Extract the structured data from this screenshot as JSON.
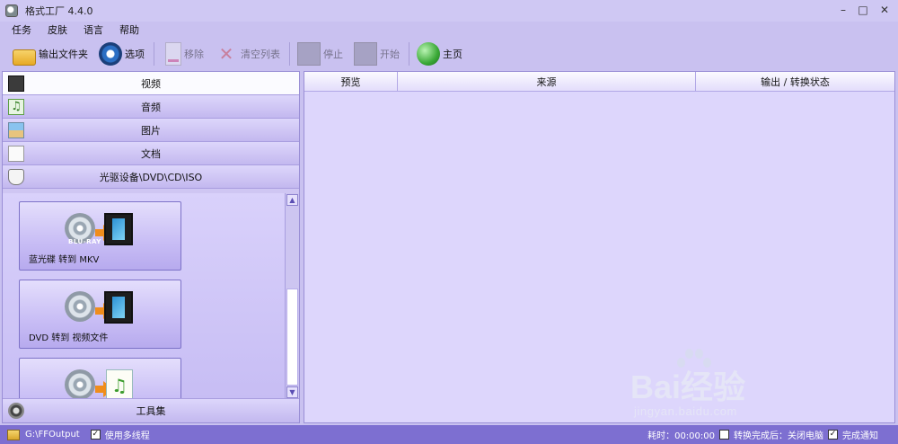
{
  "window": {
    "title": "格式工厂 4.4.0",
    "controls": [
      "–",
      "□",
      "✕"
    ]
  },
  "menu": [
    "任务",
    "皮肤",
    "语言",
    "帮助"
  ],
  "toolbar": {
    "output_folder": "输出文件夹",
    "options": "选项",
    "remove": "移除",
    "clear_list": "清空列表",
    "stop": "停止",
    "start": "开始",
    "home": "主页"
  },
  "categories": [
    {
      "label": "视频",
      "icon": "video-icon",
      "active": true
    },
    {
      "label": "音频",
      "icon": "audio-icon",
      "active": false
    },
    {
      "label": "图片",
      "icon": "picture-icon",
      "active": false
    },
    {
      "label": "文档",
      "icon": "document-icon",
      "active": false
    },
    {
      "label": "光驱设备\\DVD\\CD\\ISO",
      "icon": "disc-drive-icon",
      "active": false
    }
  ],
  "tiles": [
    {
      "label": "蓝光碟 转到 MKV",
      "disc_text": "BLU-RAY"
    },
    {
      "label": "DVD 转到 视频文件"
    },
    {
      "label": ""
    }
  ],
  "toolset_label": "工具集",
  "list_columns": [
    "预览",
    "来源",
    "输出 / 转换状态"
  ],
  "statusbar": {
    "output_path": "G:\\FFOutput",
    "multithread_label": "使用多线程",
    "multithread_checked": true,
    "elapsed_label": "耗时：00:00:00",
    "after_done_label": "转换完成后：关闭电脑",
    "after_done_checked": false,
    "notify_label": "完成通知",
    "notify_checked": true
  },
  "watermark": {
    "brand": "Bai经验",
    "url": "jingyan.baidu.com"
  }
}
